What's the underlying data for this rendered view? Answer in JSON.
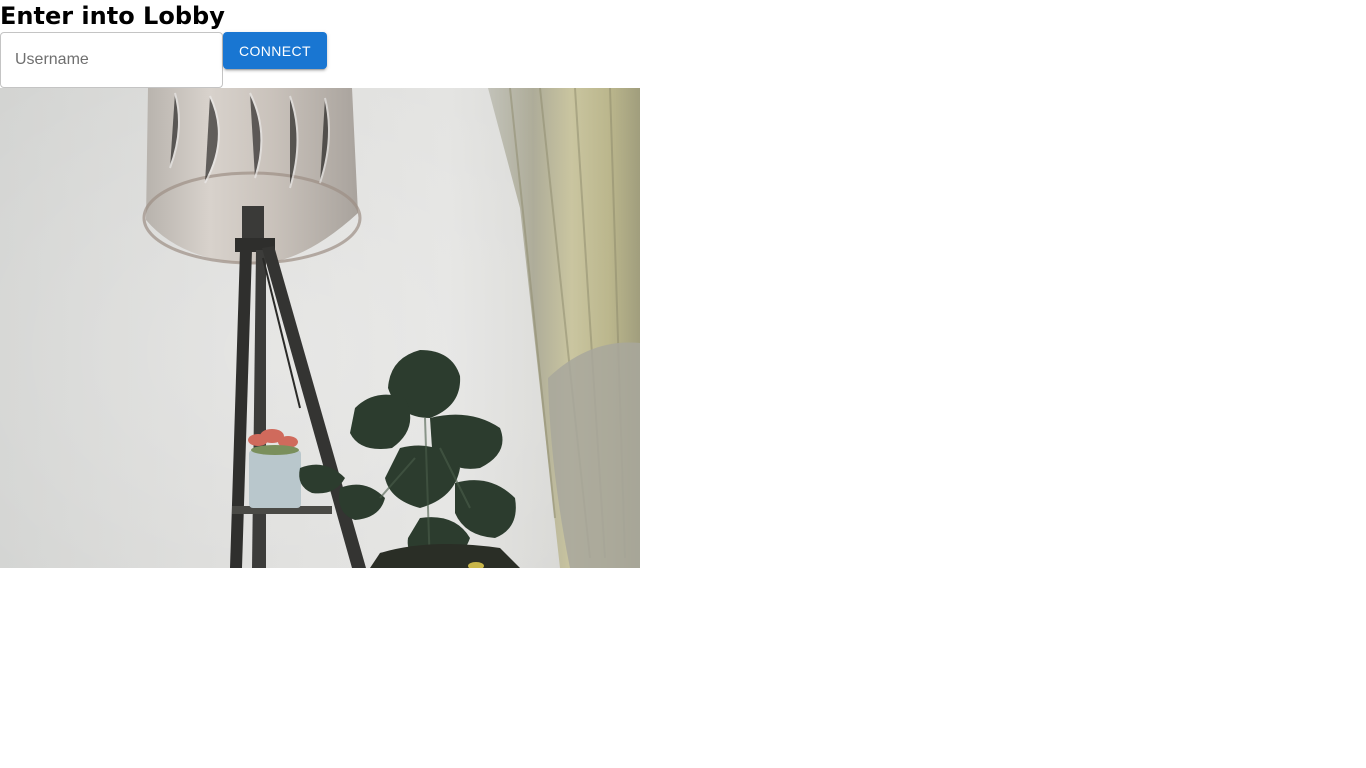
{
  "lobby": {
    "title": "Enter into Lobby",
    "username_placeholder": "Username",
    "username_value": "",
    "connect_label": "CONNECT"
  },
  "video": {
    "description_label": "camera-preview"
  },
  "colors": {
    "primary": "#1976d2",
    "input_border": "#c4c4c4"
  }
}
